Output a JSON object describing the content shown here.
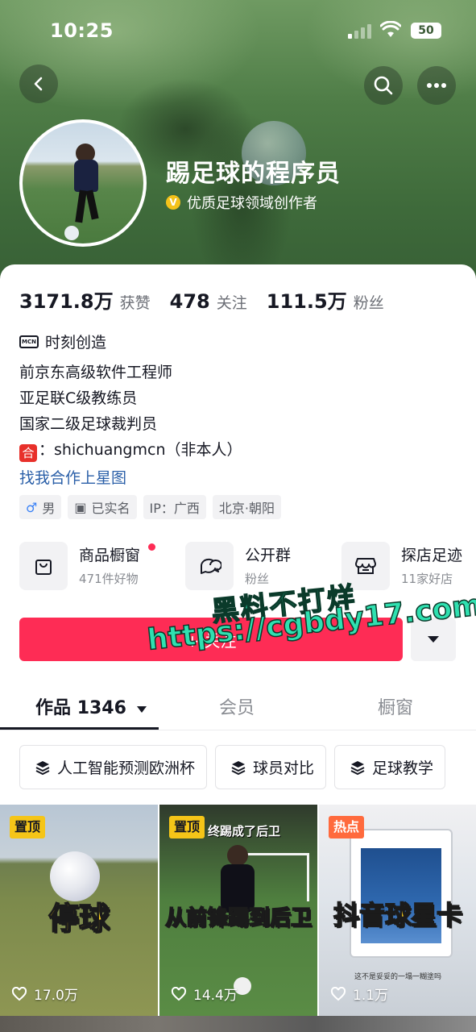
{
  "status_bar": {
    "time": "10:25",
    "battery": "50"
  },
  "profile": {
    "nickname": "踢足球的程序员",
    "verification": "优质足球领域创作者",
    "verification_badge": "V"
  },
  "stats": [
    {
      "value": "3171.8万",
      "label": "获赞"
    },
    {
      "value": "478",
      "label": "关注"
    },
    {
      "value": "111.5万",
      "label": "粉丝"
    }
  ],
  "mcn": {
    "icon_text": "MCN",
    "label": "时刻创造"
  },
  "bio": {
    "lines": [
      "前京东高级软件工程师",
      "亚足联C级教练员",
      "国家二级足球裁判员"
    ],
    "contact_badge": "合",
    "contact_text": "：shichuangmcn（非本人）"
  },
  "star_link": "找我合作上星图",
  "tags": [
    {
      "icon": "male-icon",
      "glyph": "♂",
      "label": "男"
    },
    {
      "icon": "id-card-icon",
      "glyph": "▣",
      "label": "已实名"
    },
    {
      "icon": "",
      "glyph": "",
      "label": "IP：广西"
    },
    {
      "icon": "",
      "glyph": "",
      "label": "北京·朝阳"
    }
  ],
  "shortcuts": [
    {
      "icon": "shopping-bag-icon",
      "title": "商品橱窗",
      "subtitle": "471件好物"
    },
    {
      "icon": "group-chat-icon",
      "title": "公开群",
      "subtitle": "粉丝"
    },
    {
      "icon": "store-icon",
      "title": "探店足迹",
      "subtitle": "11家好店"
    }
  ],
  "follow_button": "+ 关注",
  "tabs": {
    "works_label": "作品",
    "works_count": "1346",
    "member": "会员",
    "showcase": "橱窗"
  },
  "chips": [
    "人工智能预测欧洲杯",
    "球员对比",
    "足球教学"
  ],
  "videos": [
    {
      "badge": "置顶",
      "caption": "停球",
      "likes": "17.0万"
    },
    {
      "badge": "置顶",
      "top_text": "终踢成了后卫",
      "caption": "从前锋踢到后卫",
      "likes": "14.4万"
    },
    {
      "badge": "热点",
      "caption": "抖音球星卡",
      "bottom_text": "这不是妥妥的一塌一糊塗吗",
      "likes": "1.1万"
    }
  ],
  "watermark": {
    "line1": "黑料不打烊",
    "line2": "https://cgbdy17.com"
  },
  "colors": {
    "accent": "#fe2c55",
    "link": "#2a5fa8",
    "badge_pin": "#f5c518",
    "badge_hot": "#ff6a3d"
  }
}
